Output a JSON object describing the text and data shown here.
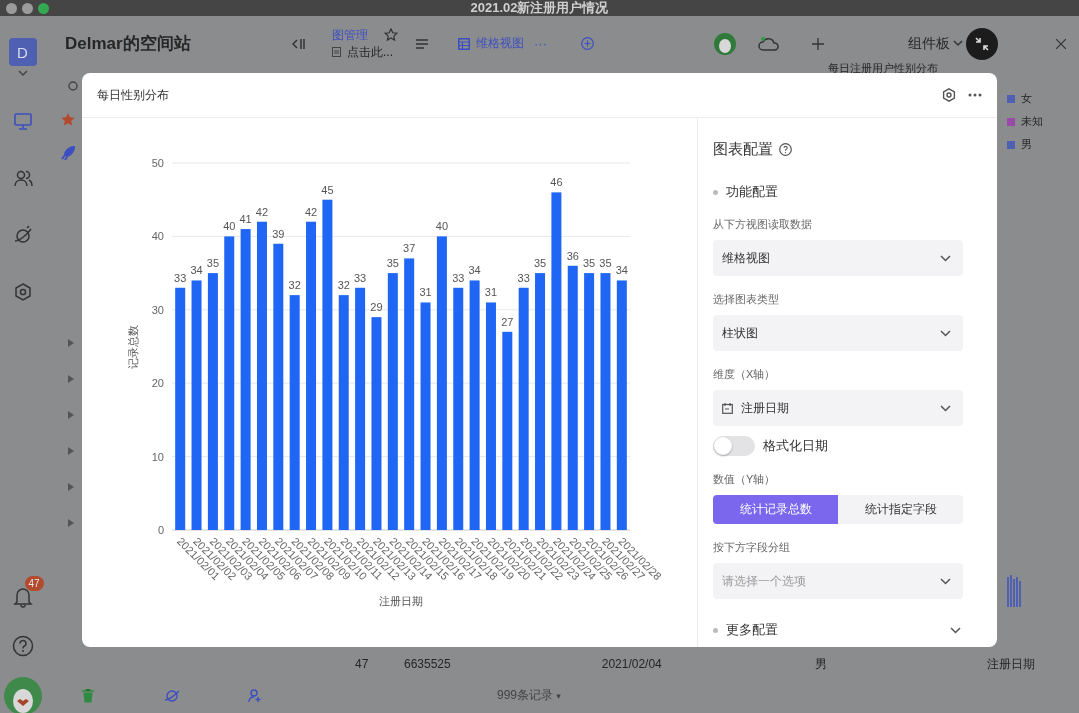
{
  "window": {
    "title": "2021.02新注册用户情况"
  },
  "sidebar": {
    "space_initial": "D",
    "nav": [
      {
        "selected": true
      },
      {
        "selected": false
      },
      {
        "selected": false
      },
      {
        "selected": false
      }
    ],
    "notification_badge": "47"
  },
  "header": {
    "space_name": "Delmar的空间站",
    "node_name": "图管理",
    "description": "点击此...",
    "view_tab": "维格视图",
    "view_more": "···",
    "widget_button": "组件板"
  },
  "widget": {
    "title": "每日注册用户性别分布",
    "legend": [
      {
        "label": "女",
        "color": "#4f5fb2"
      },
      {
        "label": "未知",
        "color": "#9a4aa8"
      },
      {
        "label": "男",
        "color": "#4f5fb2"
      }
    ],
    "axis_label": "注册日期"
  },
  "record_row": [
    "47",
    "6635525",
    "2021/02/04",
    "男"
  ],
  "footer": {
    "record_count": "999条记录",
    "caret": "▾"
  },
  "modal": {
    "title": "每日性别分布",
    "chart_data": {
      "type": "bar",
      "xlabel": "注册日期",
      "ylabel": "记录总数",
      "categories": [
        "2021/02/01",
        "2021/02/02",
        "2021/02/03",
        "2021/02/04",
        "2021/02/05",
        "2021/02/06",
        "2021/02/07",
        "2021/02/08",
        "2021/02/09",
        "2021/02/10",
        "2021/02/11",
        "2021/02/12",
        "2021/02/13",
        "2021/02/14",
        "2021/02/15",
        "2021/02/16",
        "2021/02/17",
        "2021/02/18",
        "2021/02/19",
        "2021/02/20",
        "2021/02/21",
        "2021/02/22",
        "2021/02/23",
        "2021/02/24",
        "2021/02/25",
        "2021/02/26",
        "2021/02/27",
        "2021/02/28"
      ],
      "values": [
        33,
        34,
        35,
        40,
        41,
        42,
        39,
        32,
        42,
        45,
        32,
        33,
        29,
        35,
        37,
        31,
        40,
        33,
        34,
        31,
        27,
        33,
        35,
        46,
        36,
        35,
        35,
        34
      ],
      "ylim": [
        0,
        50
      ],
      "yticks": [
        0,
        10,
        20,
        30,
        40,
        50
      ],
      "grid": true,
      "data_labels": true
    },
    "config": {
      "title": "图表配置",
      "section": "功能配置",
      "fields": [
        {
          "kind": "select",
          "label": "从下方视图读取数据",
          "value": "维格视图"
        },
        {
          "kind": "select",
          "label": "选择图表类型",
          "value": "柱状图"
        },
        {
          "kind": "field-select",
          "label": "维度（X轴）",
          "value": "注册日期"
        },
        {
          "kind": "toggle",
          "label": "格式化日期",
          "on": false
        },
        {
          "kind": "segmented",
          "label": "数值（Y轴）",
          "options": [
            {
              "label": "统计记录总数",
              "selected": true
            },
            {
              "label": "统计指定字段",
              "selected": false
            }
          ]
        },
        {
          "kind": "select",
          "label": "按下方字段分组",
          "placeholder": "请选择一个选项"
        }
      ],
      "more_section": "更多配置"
    }
  }
}
